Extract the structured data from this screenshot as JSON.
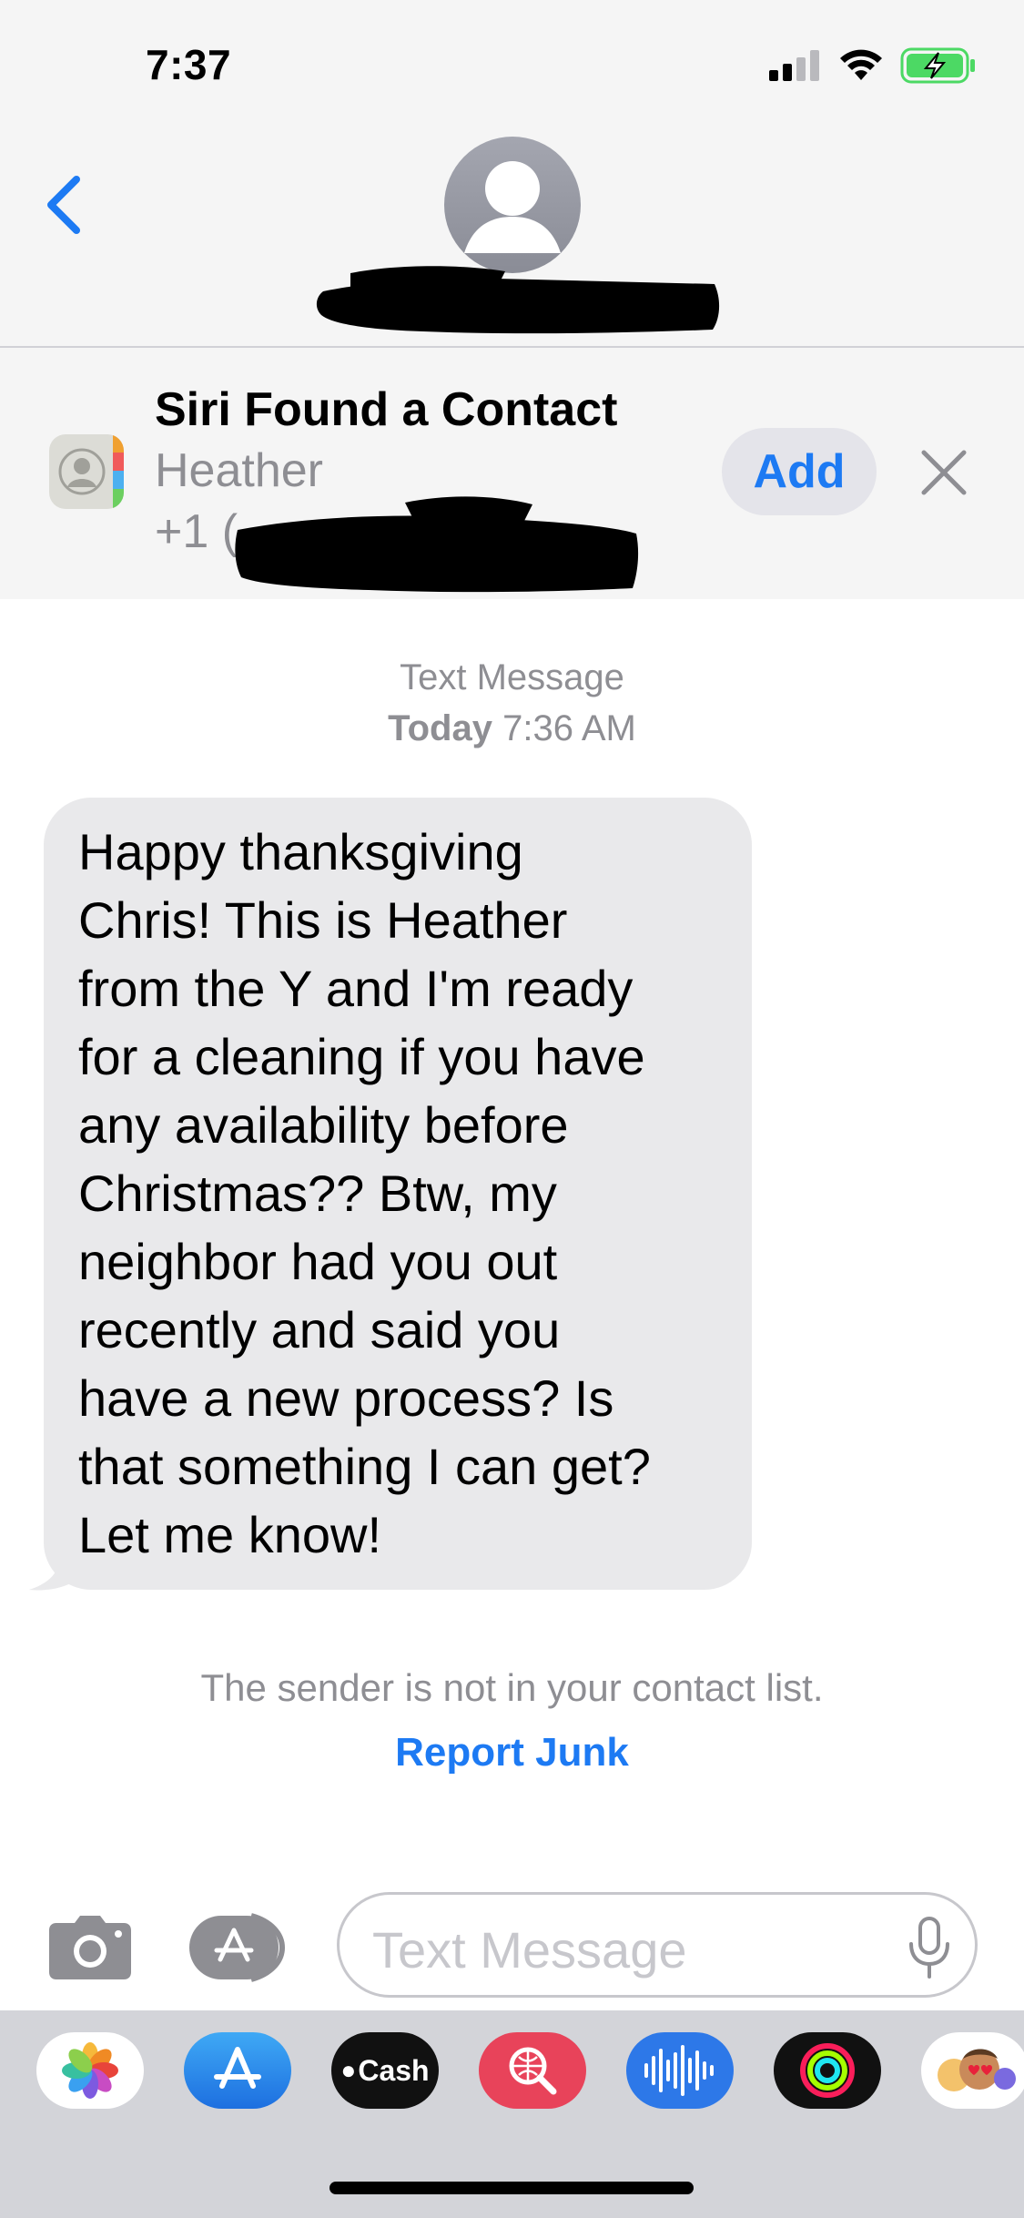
{
  "status_bar": {
    "time": "7:37"
  },
  "colors": {
    "accent": "#1d7af3",
    "battery": "#4cd964",
    "header_bg": "#f5f5f5",
    "bubble_bg": "#e9e9eb"
  },
  "siri_banner": {
    "title": "Siri Found a Contact",
    "name": "Heather",
    "phone_prefix": "+1 (",
    "add_label": "Add"
  },
  "conversation": {
    "service": "Text Message",
    "timestamp_day": "Today",
    "timestamp_time": "7:36 AM",
    "message_lines": [
      "Happy thanksgiving",
      "Chris! This is Heather",
      "from the Y and I'm ready",
      "for a cleaning if you have",
      "any availability before",
      "Christmas?? Btw, my",
      "neighbor had you out",
      "recently and said you",
      "have a new process? Is",
      "that something I can get?",
      "Let me know!"
    ],
    "junk_notice": "The sender is not in your contact list.",
    "report_junk_label": "Report Junk"
  },
  "composer": {
    "placeholder": "Text Message"
  },
  "app_drawer": {
    "apps": [
      "photos-icon",
      "app-store-icon",
      "apple-cash-icon",
      "image-search-icon",
      "audio-message-icon",
      "activity-icon",
      "memoji-icon"
    ],
    "cash_label": "Cash"
  }
}
